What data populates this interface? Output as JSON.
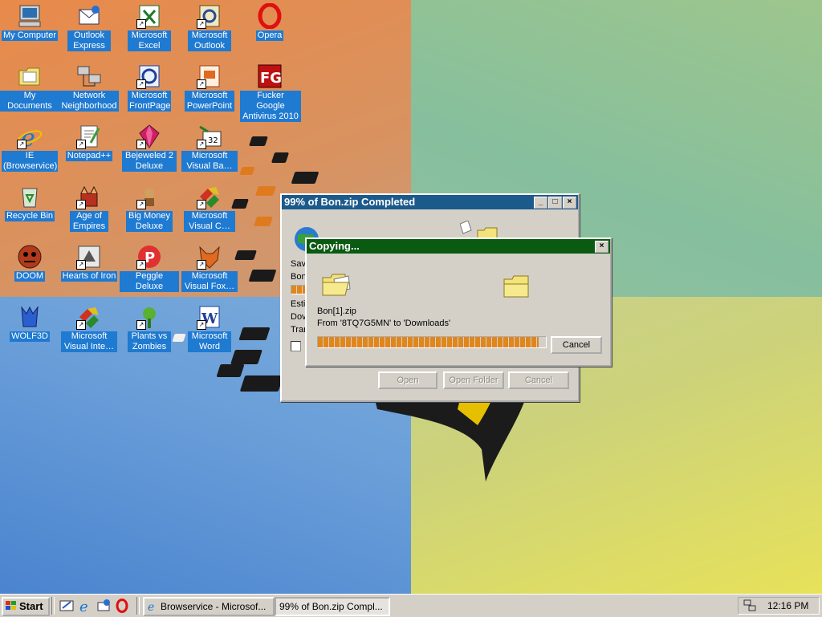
{
  "desktop": {
    "icons": [
      {
        "label": "My Computer"
      },
      {
        "label": "Outlook Express"
      },
      {
        "label": "Microsoft Excel"
      },
      {
        "label": "Microsoft Outlook"
      },
      {
        "label": "Opera"
      },
      {
        "label": "My Documents"
      },
      {
        "label": "Network Neighborhood"
      },
      {
        "label": "Microsoft FrontPage"
      },
      {
        "label": "Microsoft PowerPoint"
      },
      {
        "label": "Fucker Google Antivirus 2010"
      },
      {
        "label": "IE (Browservice)"
      },
      {
        "label": "Notepad++"
      },
      {
        "label": "Bejeweled 2 Deluxe"
      },
      {
        "label": "Microsoft Visual Ba…"
      },
      {
        "label": "Recycle Bin"
      },
      {
        "label": "Age of Empires"
      },
      {
        "label": "Big Money Deluxe"
      },
      {
        "label": "Microsoft Visual C…"
      },
      {
        "label": "DOOM"
      },
      {
        "label": "Hearts of Iron"
      },
      {
        "label": "Peggle Deluxe"
      },
      {
        "label": "Microsoft Visual Fox…"
      },
      {
        "label": "WOLF3D"
      },
      {
        "label": "Microsoft Visual Inte…"
      },
      {
        "label": "Plants vs Zombies"
      },
      {
        "label": "Microsoft Word"
      }
    ]
  },
  "download_window": {
    "title": "99% of Bon.zip Completed",
    "partial_labels": [
      "Sav",
      "Bon",
      "Esti",
      "Dov",
      "Trar"
    ],
    "buttons": {
      "open": "Open",
      "open_folder": "Open Folder",
      "cancel": "Cancel"
    },
    "progress_percent": 99
  },
  "copy_dialog": {
    "title": "Copying...",
    "filename": "Bon[1].zip",
    "from_to": "From '8TQ7G5MN' to 'Downloads'",
    "cancel_label": "Cancel",
    "progress_percent": 97
  },
  "taskbar": {
    "start_label": "Start",
    "tasks": [
      {
        "label": "Browservice - Microsof..."
      },
      {
        "label": "99% of Bon.zip Compl..."
      }
    ],
    "clock": "12:16 PM"
  },
  "colors": {
    "copy_title_bg": "#0a5a12",
    "download_title_bg": "#1c5a8c",
    "icon_label_bg": "#1f7ad1",
    "progress_fill": "#e0861c"
  }
}
